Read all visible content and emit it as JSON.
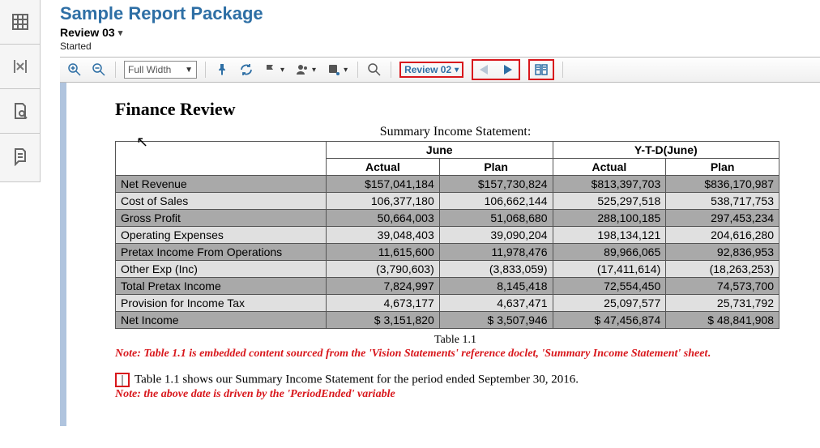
{
  "header": {
    "title": "Sample Report Package",
    "review_instance": "Review 03",
    "status": "Started"
  },
  "toolbar": {
    "zoom_select": "Full Width",
    "review_dropdown": "Review 02"
  },
  "document": {
    "title": "Finance Review",
    "table_super": "Summary Income Statement:",
    "periods": [
      "June",
      "Y-T-D(June)"
    ],
    "subcols": [
      "Actual",
      "Plan"
    ],
    "rows": [
      {
        "label": "Net Revenue",
        "shade": "shade",
        "vals": [
          "$157,041,184",
          "$157,730,824",
          "$813,397,703",
          "$836,170,987"
        ]
      },
      {
        "label": "Cost of Sales",
        "shade": "light",
        "vals": [
          "106,377,180",
          "106,662,144",
          "525,297,518",
          "538,717,753"
        ]
      },
      {
        "label": "Gross Profit",
        "shade": "shade",
        "vals": [
          "50,664,003",
          "51,068,680",
          "288,100,185",
          "297,453,234"
        ]
      },
      {
        "label": "Operating Expenses",
        "shade": "light",
        "vals": [
          "39,048,403",
          "39,090,204",
          "198,134,121",
          "204,616,280"
        ]
      },
      {
        "label": "Pretax Income From Operations",
        "shade": "shade",
        "vals": [
          "11,615,600",
          "11,978,476",
          "89,966,065",
          "92,836,953"
        ]
      },
      {
        "label": "Other Exp (Inc)",
        "shade": "light",
        "vals": [
          "(3,790,603)",
          "(3,833,059)",
          "(17,411,614)",
          "(18,263,253)"
        ]
      },
      {
        "label": "Total Pretax Income",
        "shade": "shade",
        "vals": [
          "7,824,997",
          "8,145,418",
          "72,554,450",
          "74,573,700"
        ]
      },
      {
        "label": "Provision for Income Tax",
        "shade": "light",
        "vals": [
          "4,673,177",
          "4,637,471",
          "25,097,577",
          "25,731,792"
        ]
      },
      {
        "label": "Net Income",
        "shade": "shade",
        "vals": [
          "$  3,151,820",
          "$  3,507,946",
          "$ 47,456,874",
          "$ 48,841,908"
        ]
      }
    ],
    "table_ref": "Table 1.1",
    "note1": "Note: Table 1.1 is embedded content sourced from the 'Vision Statements' reference doclet, 'Summary Income Statement' sheet",
    "note1_end": ".",
    "body_line": "Table 1.1 shows our Summary Income Statement for the period ended September 30, 2016.",
    "note2": "Note: the above date is driven by the 'PeriodEnded' variable",
    "cursor_char": "|"
  },
  "chart_data": {
    "type": "table",
    "title": "Summary Income Statement:",
    "columns": [
      "",
      "June Actual",
      "June Plan",
      "Y-T-D(June) Actual",
      "Y-T-D(June) Plan"
    ],
    "rows": [
      [
        "Net Revenue",
        157041184,
        157730824,
        813397703,
        836170987
      ],
      [
        "Cost of Sales",
        106377180,
        106662144,
        525297518,
        538717753
      ],
      [
        "Gross Profit",
        50664003,
        51068680,
        288100185,
        297453234
      ],
      [
        "Operating Expenses",
        39048403,
        39090204,
        198134121,
        204616280
      ],
      [
        "Pretax Income From Operations",
        11615600,
        11978476,
        89966065,
        92836953
      ],
      [
        "Other Exp (Inc)",
        -3790603,
        -3833059,
        -17411614,
        -18263253
      ],
      [
        "Total Pretax Income",
        7824997,
        8145418,
        72554450,
        74573700
      ],
      [
        "Provision for Income Tax",
        4673177,
        4637471,
        25097577,
        25731792
      ],
      [
        "Net Income",
        3151820,
        3507946,
        47456874,
        48841908
      ]
    ]
  }
}
